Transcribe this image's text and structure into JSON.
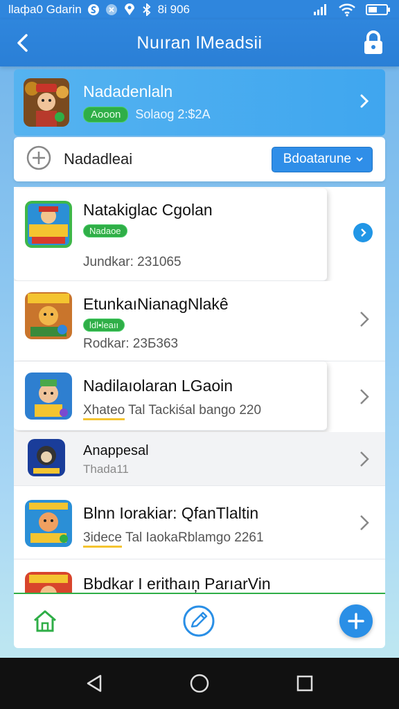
{
  "status_bar": {
    "left_text": "llaфa0 Gdarin",
    "right_text": "8i 906",
    "icons": [
      "circle-s-icon",
      "shield-icon",
      "location-icon",
      "signal-icon",
      "wifi-icon",
      "battery-icon"
    ]
  },
  "header": {
    "title": "Nuıran  lMeadsii",
    "back_icon": "chevron-left-icon",
    "action_icon": "lock-icon"
  },
  "featured": {
    "title": "Nadadenlaln",
    "badge": "Aooon",
    "meta": "Solaog 2:$2A"
  },
  "filter": {
    "label": "Nadadleai",
    "dropdown_value": "Bdoatarune"
  },
  "games": [
    {
      "title": "Natakiglac Cgolan",
      "badge": "Nadaoe",
      "sub": "Jundkar: 231065"
    },
    {
      "title": "EtunkaıNianagNlakê",
      "badge": "ldl•leaıı",
      "sub": "Rodkar: 23Б363"
    },
    {
      "title": "Nadilaıolaran LGaoin",
      "badge": "Xhateo",
      "sub": "Tal Tackiśal bango 220"
    },
    {
      "title": "Anappesal",
      "badge": "",
      "sub": "Thada11"
    },
    {
      "title": "Blnn Iorakiar: QfanTlaltin",
      "badge": "3idece",
      "sub": "Tal IaokaRblamgo 2261"
    },
    {
      "title": "Bbdkar I erithaıņ ParıarVin",
      "badge": "",
      "sub": ""
    }
  ],
  "colors": {
    "primary": "#2f86dd",
    "badge_green": "#2fae47",
    "accent_yellow": "#f4c430"
  },
  "bottom_nav": {
    "icons": [
      "home-icon",
      "edit-icon",
      "add-icon"
    ]
  },
  "system_nav": {
    "icons": [
      "back-triangle-icon",
      "home-circle-icon",
      "recents-square-icon"
    ]
  }
}
